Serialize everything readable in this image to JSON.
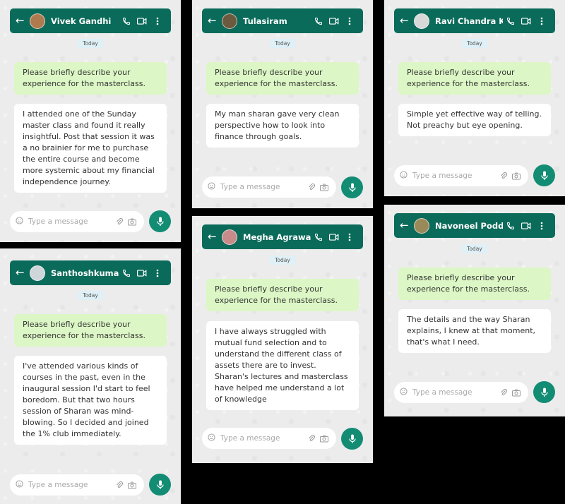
{
  "common": {
    "day_label": "Today",
    "question": "Please briefly describe your experience for the masterclass.",
    "placeholder": "Type a message"
  },
  "colors": {
    "header": "#0b6b5a",
    "mic": "#138c74",
    "question_bubble": "#dcf7c5",
    "answer_bubble": "#ffffff",
    "background": "#ececec"
  },
  "icons": [
    "back-arrow-icon",
    "phone-icon",
    "video-icon",
    "more-icon",
    "emoji-icon",
    "attach-icon",
    "camera-icon",
    "mic-icon"
  ],
  "chats": [
    {
      "name": "Vivek Gandhi",
      "avatar_color": "#b07a4f",
      "answer": "I attended one of the Sunday master class and found it really insightful. Post that session it was a no brainier for me to purchase the entire course and become more systemic about my financial independence journey."
    },
    {
      "name": "Tulasiram",
      "avatar_color": "#6b5a3e",
      "answer": "My man sharan gave very clean perspective how to look into finance through goals."
    },
    {
      "name": "Ravi Chandra K.",
      "avatar_color": "#d8d8d8",
      "answer": "Simple yet effective way of telling. Not preachy but eye opening."
    },
    {
      "name": "Santhoshkumar",
      "avatar_color": "#cfd6da",
      "answer": "I've attended various kinds of courses in the past, even in the inaugural session I'd start to feel boredom. But that two hours session of Sharan was mind-blowing. So I decided and joined the 1% club immediately."
    },
    {
      "name": "Megha Agrawal",
      "avatar_color": "#c98a8a",
      "answer": "I have always struggled with mutual fund selection and to understand the different class of assets there are to invest. Sharan's lectures and masterclass have helped me understand a lot of knowledge"
    },
    {
      "name": "Navoneel Poddar",
      "avatar_color": "#9a8a5a",
      "answer": "The details and the way Sharan explains, I knew at that moment, that's what I need."
    }
  ]
}
